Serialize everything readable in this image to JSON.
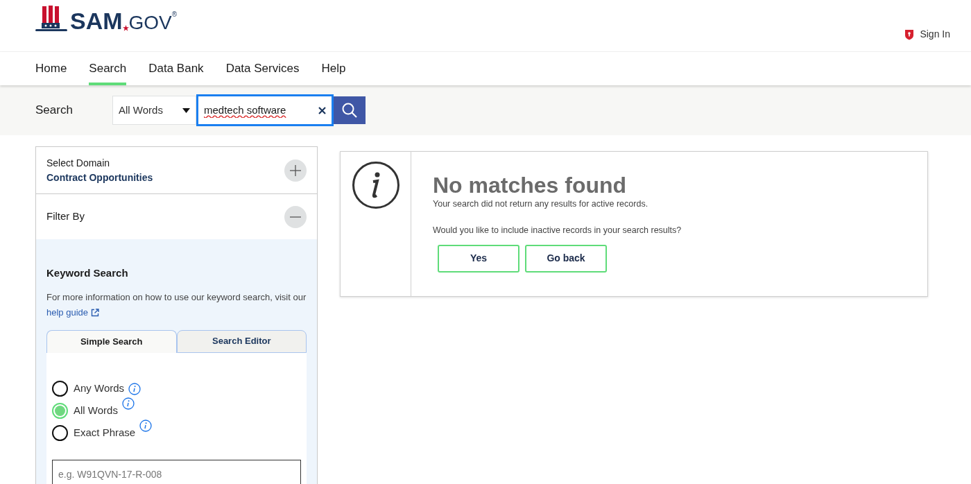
{
  "logo": {
    "primary": "SAM",
    "secondary": "GOV",
    "mark": "®"
  },
  "sign_in": {
    "label": "Sign In"
  },
  "nav": [
    {
      "label": "Home",
      "selected": false
    },
    {
      "label": "Search",
      "selected": true
    },
    {
      "label": "Data Bank",
      "selected": false
    },
    {
      "label": "Data Services",
      "selected": false
    },
    {
      "label": "Help",
      "selected": false
    }
  ],
  "search_bar": {
    "label": "Search",
    "mode": "All Words",
    "value": "medtech software"
  },
  "sidebar": {
    "domain": {
      "label": "Select Domain",
      "value": "Contract Opportunities",
      "expanded": false
    },
    "filter": {
      "label": "Filter By",
      "expanded": true
    },
    "keyword": {
      "title": "Keyword Search",
      "help_text": "For more information on how to use our keyword search, visit our",
      "help_link": "help guide",
      "tabs": [
        {
          "label": "Simple Search",
          "selected": true
        },
        {
          "label": "Search Editor",
          "selected": false
        }
      ],
      "options": [
        {
          "label": "Any Words",
          "selected": false
        },
        {
          "label": "All Words",
          "selected": true
        },
        {
          "label": "Exact Phrase",
          "selected": false
        }
      ],
      "placeholder": "e.g. W91QVN-17-R-008"
    }
  },
  "result": {
    "title": "No matches found",
    "message": "Your search did not return any results for active records.",
    "question": "Would you like to include inactive records in your search results?",
    "buttons": [
      "Yes",
      "Go back"
    ]
  }
}
